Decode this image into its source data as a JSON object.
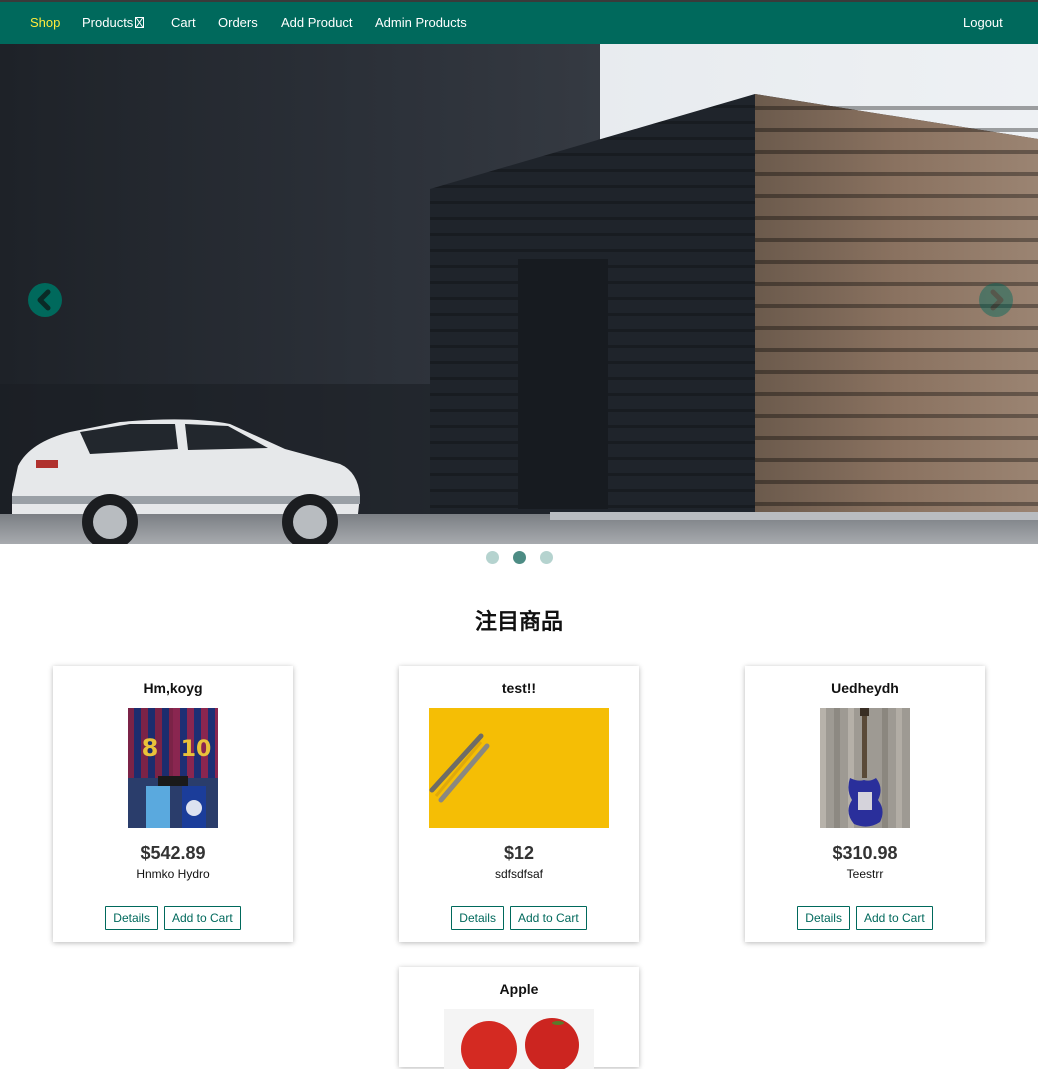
{
  "nav": {
    "items": [
      {
        "label": "Shop",
        "active": true
      },
      {
        "label": "Products",
        "dropdown": true
      },
      {
        "label": "Cart"
      },
      {
        "label": "Orders"
      },
      {
        "label": "Add Product"
      },
      {
        "label": "Admin Products"
      }
    ],
    "logout_label": "Logout",
    "bg_color": "#00695c",
    "active_color": "#ffeb3b"
  },
  "carousel": {
    "prev_icon": "chevron-left-icon",
    "next_icon": "chevron-right-icon",
    "slide_count": 3,
    "active_slide": 2
  },
  "featured": {
    "title": "注目商品",
    "products": [
      {
        "title": "Hm,koyg",
        "price": "$542.89",
        "description": "Hnmko Hydro",
        "image": "football-jerseys",
        "details_label": "Details",
        "cart_label": "Add to Cart"
      },
      {
        "title": "test!!",
        "price": "$12",
        "description": "sdfsdfsaf",
        "image": "pencils-on-yellow",
        "details_label": "Details",
        "cart_label": "Add to Cart"
      },
      {
        "title": "Uedheydh",
        "price": "$310.98",
        "description": "Teestrr",
        "image": "electric-guitar",
        "details_label": "Details",
        "cart_label": "Add to Cart"
      },
      {
        "title": "Apple",
        "image": "apples"
      }
    ]
  }
}
